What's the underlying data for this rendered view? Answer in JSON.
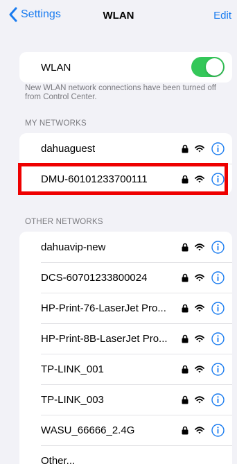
{
  "nav": {
    "back_label": "Settings",
    "title": "WLAN",
    "edit_label": "Edit"
  },
  "wlan": {
    "label": "WLAN",
    "enabled": true,
    "toggle_color": "#34c759",
    "footnote": "New WLAN network connections have been turned off from Control Center."
  },
  "my_networks": {
    "header": "MY NETWORKS",
    "items": [
      {
        "name": "dahuaguest",
        "secured": true,
        "highlighted": false
      },
      {
        "name": "DMU-60101233700111",
        "secured": true,
        "highlighted": true
      }
    ]
  },
  "other_networks": {
    "header": "OTHER NETWORKS",
    "items": [
      {
        "name": "dahuavip-new",
        "secured": true
      },
      {
        "name": "DCS-60701233800024",
        "secured": true
      },
      {
        "name": "HP-Print-76-LaserJet Pro...",
        "secured": true
      },
      {
        "name": "HP-Print-8B-LaserJet Pro...",
        "secured": true
      },
      {
        "name": "TP-LINK_001",
        "secured": true
      },
      {
        "name": "TP-LINK_003",
        "secured": true
      },
      {
        "name": "WASU_66666_2.4G",
        "secured": true
      }
    ],
    "other_label": "Other..."
  },
  "colors": {
    "accent": "#1a7cf0",
    "highlight_border": "#ee0000",
    "background": "#f2f2f7"
  },
  "icons": {
    "back": "chevron-left-icon",
    "lock": "lock-icon",
    "wifi": "wifi-icon",
    "info": "info-icon"
  }
}
